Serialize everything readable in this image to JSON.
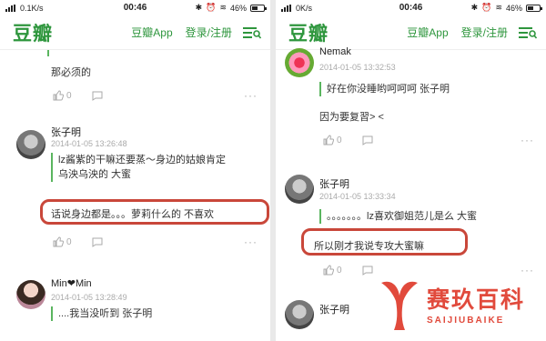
{
  "left": {
    "status": {
      "speed": "0.1K/s",
      "time": "00:46",
      "battery": "46%"
    },
    "nav": {
      "logo": "豆瓣",
      "app": "豆瓣App",
      "login": "登录/注册"
    },
    "prev_text": "那必须的",
    "likes_prev": "0",
    "c1": {
      "name": "张子明",
      "date": "2014-01-05 13:26:48",
      "quote": "lz酱紫的干嘛还要蒸～身边的姑娘肯定乌泱乌泱的 大蜜",
      "text": "话说身边都是。。。萝莉什么的 不喜欢",
      "likes": "0"
    },
    "c2": {
      "name": "Min❤Min",
      "date": "2014-01-05 13:28:49",
      "quote": "....我当没听到 张子明"
    }
  },
  "right": {
    "status": {
      "speed": "0K/s",
      "time": "00:46",
      "battery": "46%"
    },
    "nav": {
      "logo": "豆瓣",
      "app": "豆瓣App",
      "login": "登录/注册"
    },
    "c0": {
      "name": "Nemak",
      "date": "2014-01-05 13:32:53",
      "quote": "好在你没睡哟呵呵呵 张子明",
      "text": "因为要复習> <",
      "likes": "0"
    },
    "c1": {
      "name": "张子明",
      "date": "2014-01-05 13:33:34",
      "quote": "。。。。。。。lz喜欢御姐范儿是么 大蜜",
      "text": "所以刚才我说专攻大蜜嘛",
      "likes": "0"
    },
    "c2": {
      "name": "张子明"
    }
  },
  "watermark": {
    "cn": "赛玖百科",
    "en": "SAIJIUBAIKE"
  },
  "colors": {
    "brand_green": "#2e963d",
    "quote_bar": "#5ab55f",
    "highlight": "#c9473a",
    "watermark": "#e14a3c"
  },
  "icons": {
    "like": "thumb-up-icon",
    "reply": "speech-bubble-icon",
    "more": "ellipsis-icon",
    "menu": "menu-search-icon"
  }
}
